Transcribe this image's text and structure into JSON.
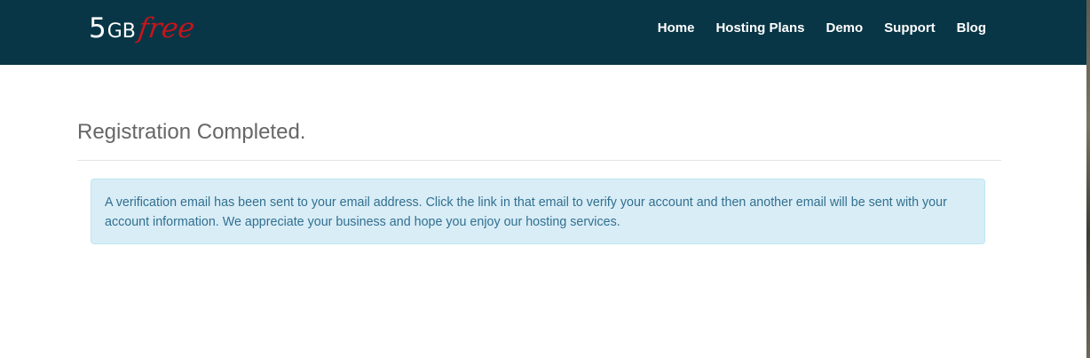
{
  "brand": {
    "number": "5",
    "unit": "GB",
    "word": "free"
  },
  "nav": {
    "items": [
      {
        "label": "Home"
      },
      {
        "label": "Hosting Plans"
      },
      {
        "label": "Demo"
      },
      {
        "label": "Support"
      },
      {
        "label": "Blog"
      }
    ]
  },
  "main": {
    "title": "Registration Completed.",
    "alert_message": "A verification email has been sent to your email address. Click the link in that email to verify your account and then another email will be sent with your account information. We appreciate your business and hope you enjoy our hosting services."
  },
  "colors": {
    "navbar_bg": "#083646",
    "brand_accent": "#c8141b",
    "alert_bg": "#d9edf7",
    "alert_border": "#bce8f1",
    "alert_text": "#31708f"
  }
}
